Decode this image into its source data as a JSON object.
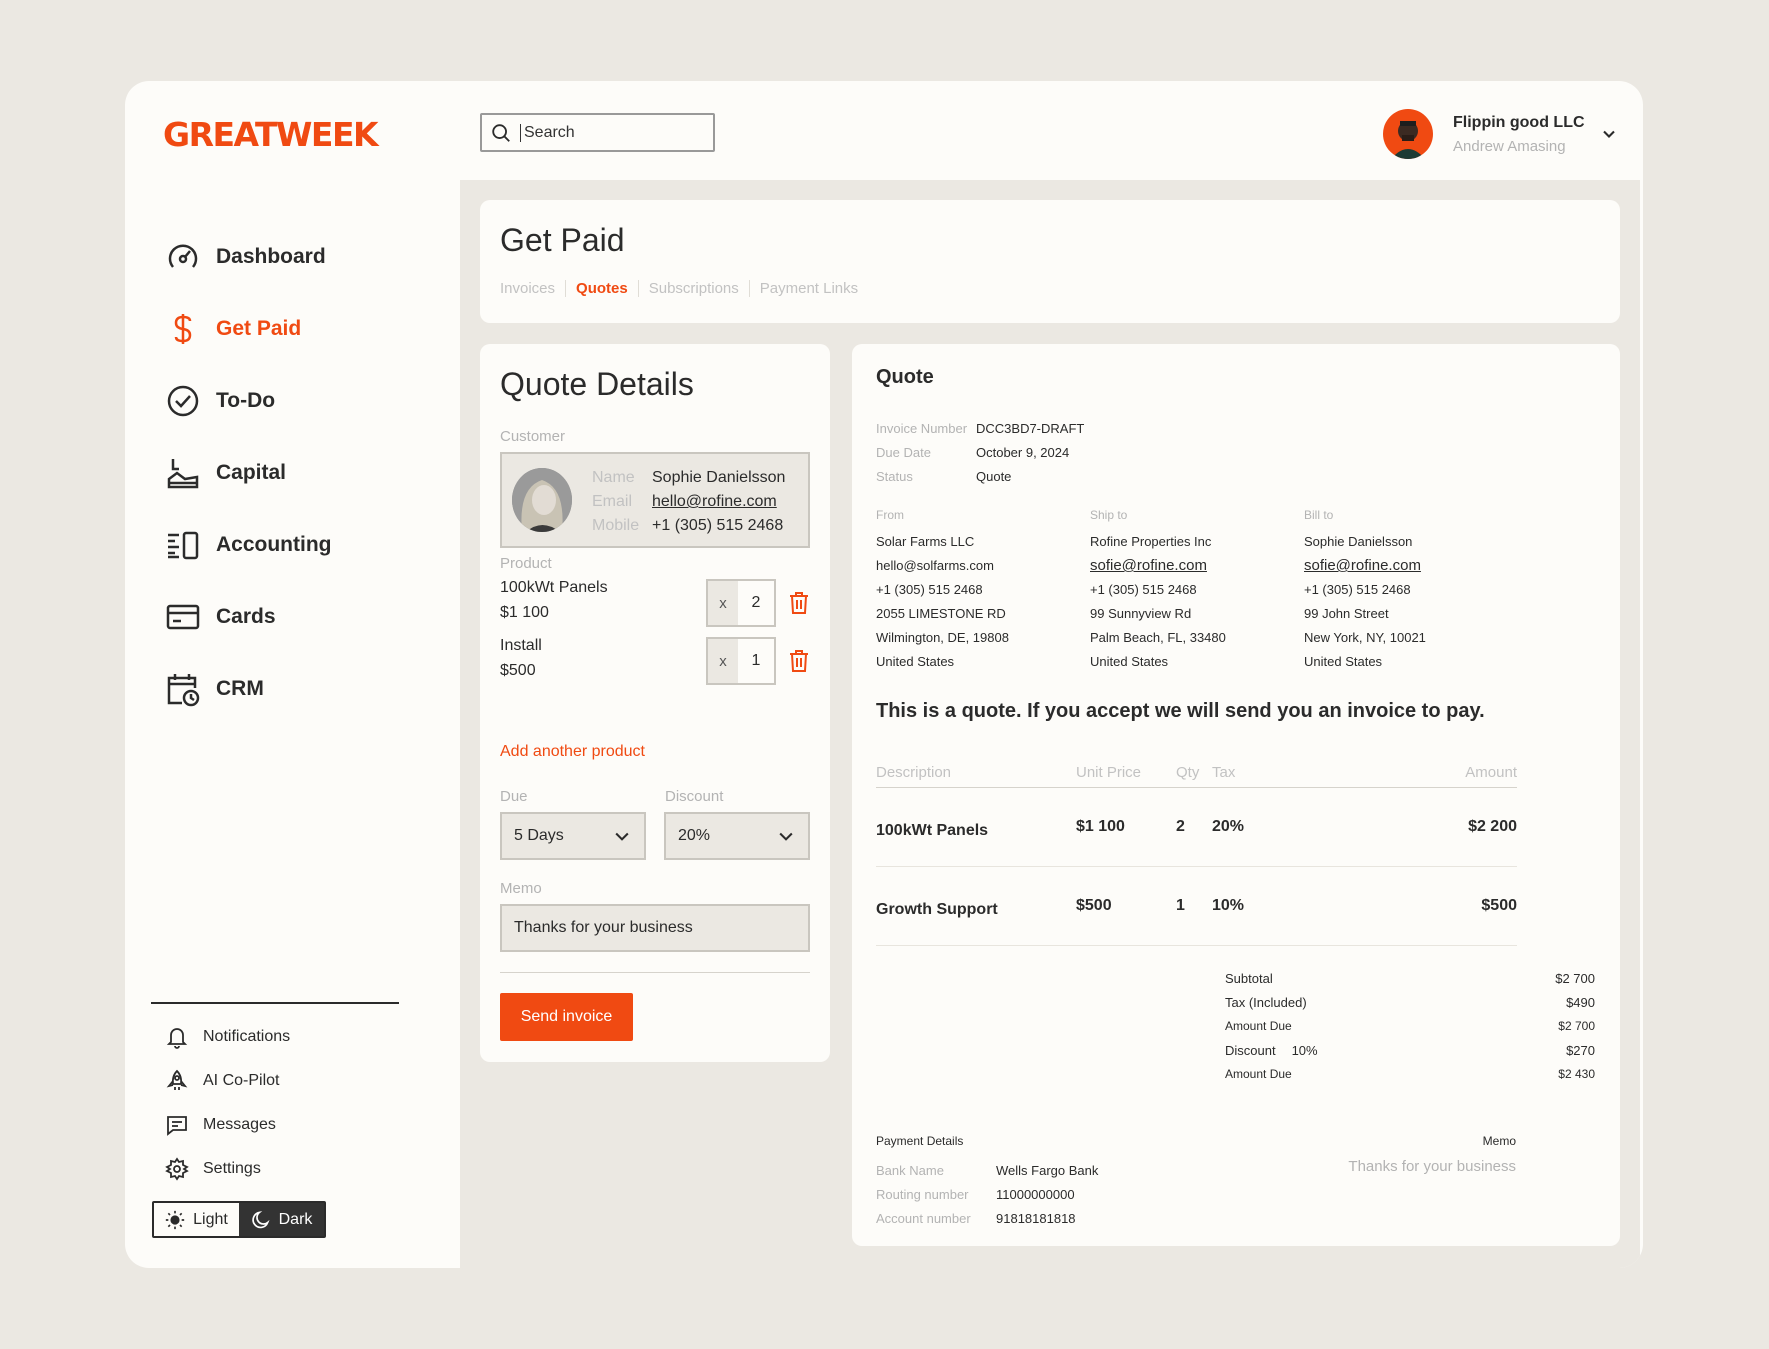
{
  "brand": {
    "logo_text": "GREATWEEK",
    "accent": "#f04a12"
  },
  "search": {
    "placeholder": "Search",
    "icon": "search-icon"
  },
  "account": {
    "company": "Flippin good LLC",
    "user": "Andrew Amasing"
  },
  "nav": {
    "items": [
      {
        "label": "Dashboard",
        "icon": "gauge-icon",
        "active": false
      },
      {
        "label": "Get Paid",
        "icon": "dollar-icon",
        "active": true
      },
      {
        "label": "To-Do",
        "icon": "check-circle-icon",
        "active": false
      },
      {
        "label": "Capital",
        "icon": "capital-icon",
        "active": false
      },
      {
        "label": "Accounting",
        "icon": "accounting-icon",
        "active": false
      },
      {
        "label": "Cards",
        "icon": "card-icon",
        "active": false
      },
      {
        "label": "CRM",
        "icon": "calendar-clock-icon",
        "active": false
      }
    ]
  },
  "secondary_nav": {
    "items": [
      {
        "label": "Notifications",
        "icon": "bell-icon"
      },
      {
        "label": "AI Co-Pilot",
        "icon": "rocket-icon"
      },
      {
        "label": "Messages",
        "icon": "message-icon"
      },
      {
        "label": "Settings",
        "icon": "gear-icon"
      }
    ]
  },
  "theme": {
    "light": "Light",
    "dark": "Dark"
  },
  "header": {
    "title": "Get Paid",
    "tabs": [
      {
        "label": "Invoices",
        "active": false
      },
      {
        "label": "Quotes",
        "active": true
      },
      {
        "label": "Subscriptions",
        "active": false
      },
      {
        "label": "Payment Links",
        "active": false
      }
    ]
  },
  "quote_details": {
    "title": "Quote Details",
    "customer_label": "Customer",
    "customer": {
      "name_key": "Name",
      "name": "Sophie Danielsson",
      "email_key": "Email",
      "email": "hello@rofine.com",
      "mobile_key": "Mobile",
      "mobile": "+1 (305) 515 2468"
    },
    "product_label": "Product",
    "products": [
      {
        "name": "100kWt Panels",
        "price": "$1 100",
        "x": "x",
        "qty": "2"
      },
      {
        "name": "Install",
        "price": "$500",
        "x": "x",
        "qty": "1"
      }
    ],
    "add_product": "Add another product",
    "due_label": "Due",
    "due_value": "5 Days",
    "discount_label": "Discount",
    "discount_value": "20%",
    "memo_label": "Memo",
    "memo_value": "Thanks for your business",
    "send_button": "Send invoice"
  },
  "quote": {
    "title": "Quote",
    "meta": [
      {
        "key": "Invoice Number",
        "value": "DCC3BD7-DRAFT"
      },
      {
        "key": "Due Date",
        "value": "October 9, 2024"
      },
      {
        "key": "Status",
        "value": "Quote"
      }
    ],
    "from": {
      "heading": "From",
      "lines": [
        "Solar Farms LLC",
        "hello@solfarms.com",
        "+1 (305) 515 2468",
        "2055 LIMESTONE RD",
        "Wilmington, DE, 19808",
        "United States"
      ]
    },
    "ship_to": {
      "heading": "Ship to",
      "lines": [
        "Rofine Properties Inc",
        "sofie@rofine.com",
        "+1 (305) 515 2468",
        "99 Sunnyview Rd",
        "Palm Beach, FL, 33480",
        "United States"
      ]
    },
    "bill_to": {
      "heading": "Bill to",
      "lines": [
        "Sophie Danielsson",
        "sofie@rofine.com",
        "+1 (305) 515 2468",
        "99 John Street",
        "New York, NY, 10021",
        "United States"
      ]
    },
    "message": "This is a quote. If you accept we will send you an invoice to pay.",
    "columns": [
      "Description",
      "Unit Price",
      "Qty",
      "Tax",
      "Amount"
    ],
    "rows": [
      [
        "100kWt Panels",
        "$1 100",
        "2",
        "20%",
        "$2 200"
      ],
      [
        "Growth Support",
        "$500",
        "1",
        "10%",
        "$500"
      ]
    ],
    "totals": [
      {
        "label": "Subtotal",
        "value": "$2 700"
      },
      {
        "label": "Tax (Included)",
        "value": "$490"
      },
      {
        "label": "Amount Due",
        "value": "$2 700"
      },
      {
        "label": "Discount",
        "extra": "10%",
        "value": "$270"
      },
      {
        "label": "Amount Due",
        "value": "$2 430"
      }
    ],
    "payment": {
      "title": "Payment Details",
      "rows": [
        {
          "key": "Bank Name",
          "value": "Wells Fargo Bank"
        },
        {
          "key": "Routing number",
          "value": "11000000000"
        },
        {
          "key": "Account number",
          "value": "91818181818"
        }
      ]
    },
    "memo": {
      "heading": "Memo",
      "text": "Thanks for your business"
    }
  }
}
